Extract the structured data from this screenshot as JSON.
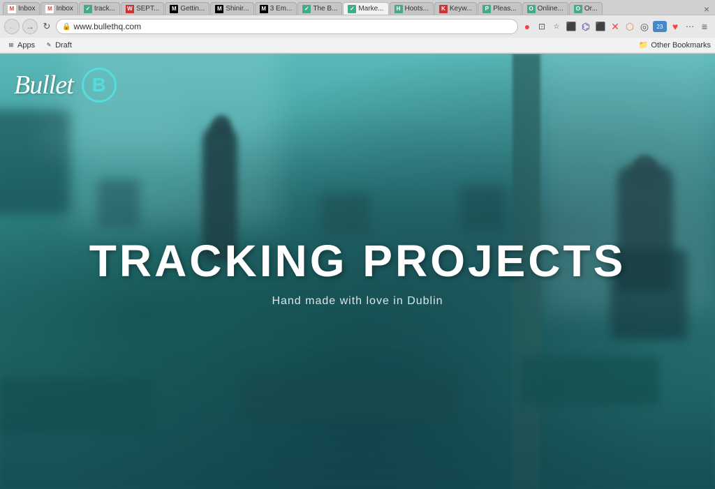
{
  "browser": {
    "tabs": [
      {
        "label": "Inbox",
        "icon": "M",
        "icon_class": "gmail",
        "active": false
      },
      {
        "label": "Inbox",
        "icon": "M",
        "icon_class": "gmail",
        "active": false
      },
      {
        "label": "track...",
        "icon": "✓",
        "icon_class": "blue",
        "active": false
      },
      {
        "label": "SEPT...",
        "icon": "W",
        "icon_class": "red",
        "active": false
      },
      {
        "label": "Gettin...",
        "icon": "M",
        "icon_class": "medium",
        "active": false
      },
      {
        "label": "Shinin...",
        "icon": "M",
        "icon_class": "medium",
        "active": false
      },
      {
        "label": "3 Em...",
        "icon": "M",
        "icon_class": "medium",
        "active": false
      },
      {
        "label": "The B...",
        "icon": "✓",
        "icon_class": "blue",
        "active": false
      },
      {
        "label": "Marke...",
        "icon": "✓",
        "icon_class": "blue",
        "active": true
      },
      {
        "label": "Hoots...",
        "icon": "H",
        "icon_class": "blue",
        "active": false
      },
      {
        "label": "Keyw...",
        "icon": "K",
        "icon_class": "red",
        "active": false
      },
      {
        "label": "Pleas...",
        "icon": "P",
        "icon_class": "blue",
        "active": false
      },
      {
        "label": "Online...",
        "icon": "O",
        "icon_class": "blue",
        "active": false
      },
      {
        "label": "Or...",
        "icon": "O",
        "icon_class": "blue",
        "active": false
      }
    ],
    "close_icon": "×",
    "address": "www.bullethq.com",
    "bookmarks": [
      {
        "label": "Apps",
        "icon": "⊞",
        "is_folder": false
      },
      {
        "label": "Draft",
        "icon": "✎",
        "is_folder": false
      }
    ],
    "bookmarks_right": "Other Bookmarks"
  },
  "page": {
    "logo_text": "Bullet",
    "logo_circle_letter": "B",
    "headline": "TRACKING PROJECTS",
    "subheadline": "Hand made with love in Dublin",
    "bg_color": "#3a9898"
  }
}
